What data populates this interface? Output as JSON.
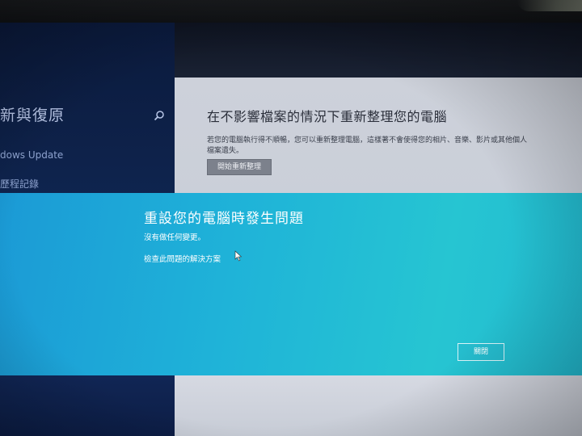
{
  "settings": {
    "left_title": "新與復原",
    "left_items": [
      "dows Update",
      "歷程記錄"
    ],
    "section_title": "在不影響檔案的情況下重新整理您的電腦",
    "section_desc": "若您的電腦執行得不順暢，您可以重新整理電腦，這樣著不會使得您的相片、音樂、影片或其他個人檔案遺失。",
    "refresh_button_label": "開始重新整理"
  },
  "dialog": {
    "title": "重設您的電腦時發生問題",
    "message": "沒有做任何變更。",
    "link": "檢查此問題的解決方案",
    "close_label": "關閉"
  },
  "icons": {
    "search": "search-icon",
    "cursor": "mouse-cursor-icon"
  },
  "colors": {
    "dialog_accent": "#1fb3d8",
    "nav_background": "#0f2550",
    "content_background": "#cdd1da"
  }
}
